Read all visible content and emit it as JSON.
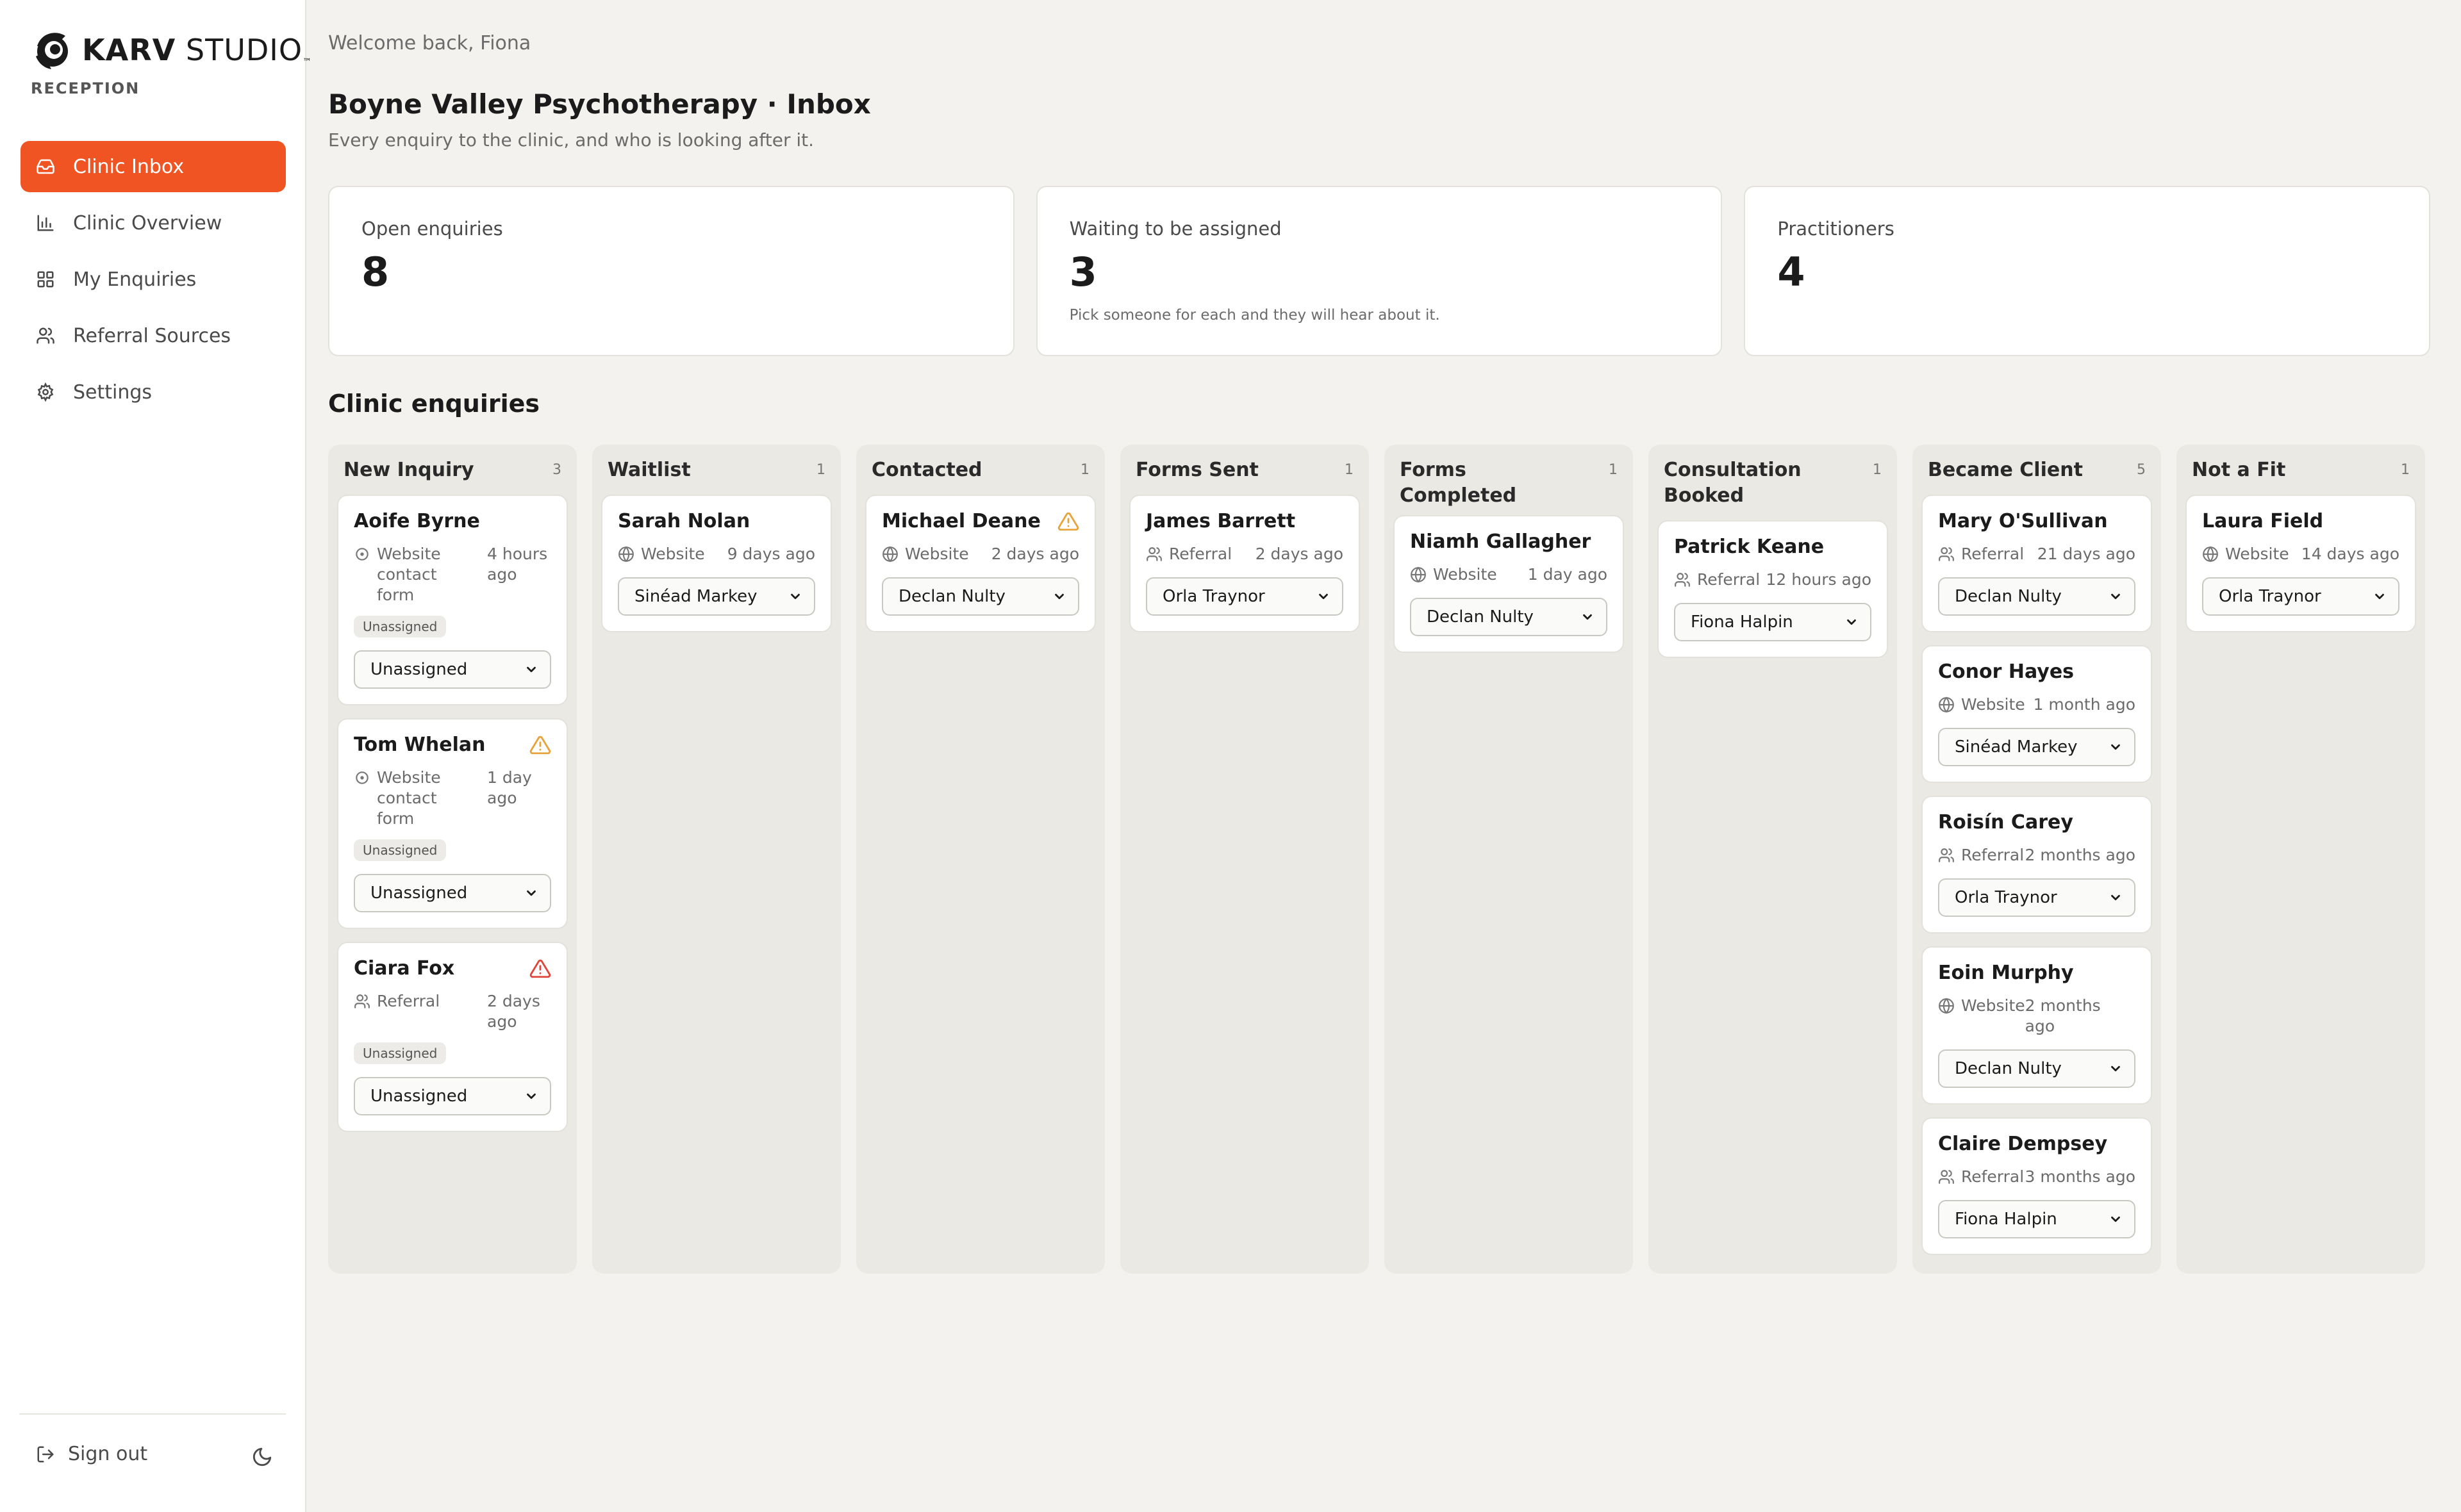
{
  "brand": {
    "name_bold": "KARV",
    "name_light": "STUDIO",
    "tm": "™",
    "sub": "RECEPTION"
  },
  "nav": [
    {
      "label": "Clinic Inbox",
      "icon": "inbox-icon",
      "active": true
    },
    {
      "label": "Clinic Overview",
      "icon": "bar-chart-icon",
      "active": false
    },
    {
      "label": "My Enquiries",
      "icon": "grid-icon",
      "active": false
    },
    {
      "label": "Referral Sources",
      "icon": "users-icon",
      "active": false
    },
    {
      "label": "Settings",
      "icon": "gear-icon",
      "active": false
    }
  ],
  "footer": {
    "signout": "Sign out",
    "theme_icon": "moon-icon"
  },
  "header": {
    "welcome": "Welcome back, Fiona",
    "title": "Boyne Valley Psychotherapy · Inbox",
    "subtitle": "Every enquiry to the clinic, and who is looking after it."
  },
  "stats": [
    {
      "label": "Open enquiries",
      "value": "8",
      "note": ""
    },
    {
      "label": "Waiting to be assigned",
      "value": "3",
      "note": "Pick someone for each and they will hear about it."
    },
    {
      "label": "Practitioners",
      "value": "4",
      "note": ""
    }
  ],
  "section_title": "Clinic enquiries",
  "columns": [
    {
      "title": "New Inquiry",
      "count": "3",
      "cards": [
        {
          "name": "Aoife Byrne",
          "source": "Website contact form",
          "source_icon": "clock-icon",
          "time": "4 hours ago",
          "badge": "Unassigned",
          "assignee": "Unassigned",
          "warning": ""
        },
        {
          "name": "Tom Whelan",
          "source": "Website contact form",
          "source_icon": "clock-icon",
          "time": "1 day ago",
          "badge": "Unassigned",
          "assignee": "Unassigned",
          "warning": "amber"
        },
        {
          "name": "Ciara Fox",
          "source": "Referral",
          "source_icon": "users-icon",
          "time": "2 days ago",
          "badge": "Unassigned",
          "assignee": "Unassigned",
          "warning": "red"
        }
      ]
    },
    {
      "title": "Waitlist",
      "count": "1",
      "cards": [
        {
          "name": "Sarah Nolan",
          "source": "Website",
          "source_icon": "globe-icon",
          "time": "9 days ago",
          "badge": "",
          "assignee": "Sinéad Markey",
          "warning": ""
        }
      ]
    },
    {
      "title": "Contacted",
      "count": "1",
      "cards": [
        {
          "name": "Michael Deane",
          "source": "Website",
          "source_icon": "globe-icon",
          "time": "2 days ago",
          "badge": "",
          "assignee": "Declan Nulty",
          "warning": "amber"
        }
      ]
    },
    {
      "title": "Forms Sent",
      "count": "1",
      "cards": [
        {
          "name": "James Barrett",
          "source": "Referral",
          "source_icon": "users-icon",
          "time": "2 days ago",
          "badge": "",
          "assignee": "Orla Traynor",
          "warning": ""
        }
      ]
    },
    {
      "title": "Forms Completed",
      "count": "1",
      "cards": [
        {
          "name": "Niamh Gallagher",
          "source": "Website",
          "source_icon": "globe-icon",
          "time": "1 day ago",
          "badge": "",
          "assignee": "Declan Nulty",
          "warning": ""
        }
      ]
    },
    {
      "title": "Consultation Booked",
      "count": "1",
      "cards": [
        {
          "name": "Patrick Keane",
          "source": "Referral",
          "source_icon": "users-icon",
          "time": "12 hours ago",
          "badge": "",
          "assignee": "Fiona Halpin",
          "warning": ""
        }
      ]
    },
    {
      "title": "Became Client",
      "count": "5",
      "cards": [
        {
          "name": "Mary O'Sullivan",
          "source": "Referral",
          "source_icon": "users-icon",
          "time": "21 days ago",
          "badge": "",
          "assignee": "Declan Nulty",
          "warning": ""
        },
        {
          "name": "Conor Hayes",
          "source": "Website",
          "source_icon": "globe-icon",
          "time": "1 month ago",
          "badge": "",
          "assignee": "Sinéad Markey",
          "warning": ""
        },
        {
          "name": "Roisín Carey",
          "source": "Referral",
          "source_icon": "users-icon",
          "time": "2 months ago",
          "badge": "",
          "assignee": "Orla Traynor",
          "warning": ""
        },
        {
          "name": "Eoin Murphy",
          "source": "Website",
          "source_icon": "globe-icon",
          "time": "2 months ago",
          "badge": "",
          "assignee": "Declan Nulty",
          "warning": ""
        },
        {
          "name": "Claire Dempsey",
          "source": "Referral",
          "source_icon": "users-icon",
          "time": "3 months ago",
          "badge": "",
          "assignee": "Fiona Halpin",
          "warning": ""
        }
      ]
    },
    {
      "title": "Not a Fit",
      "count": "1",
      "cards": [
        {
          "name": "Laura Field",
          "source": "Website",
          "source_icon": "globe-icon",
          "time": "14 days ago",
          "badge": "",
          "assignee": "Orla Traynor",
          "warning": ""
        }
      ]
    }
  ],
  "colors": {
    "accent": "#f05423",
    "warning_amber": "#e8a33a",
    "warning_red": "#e0453a"
  }
}
